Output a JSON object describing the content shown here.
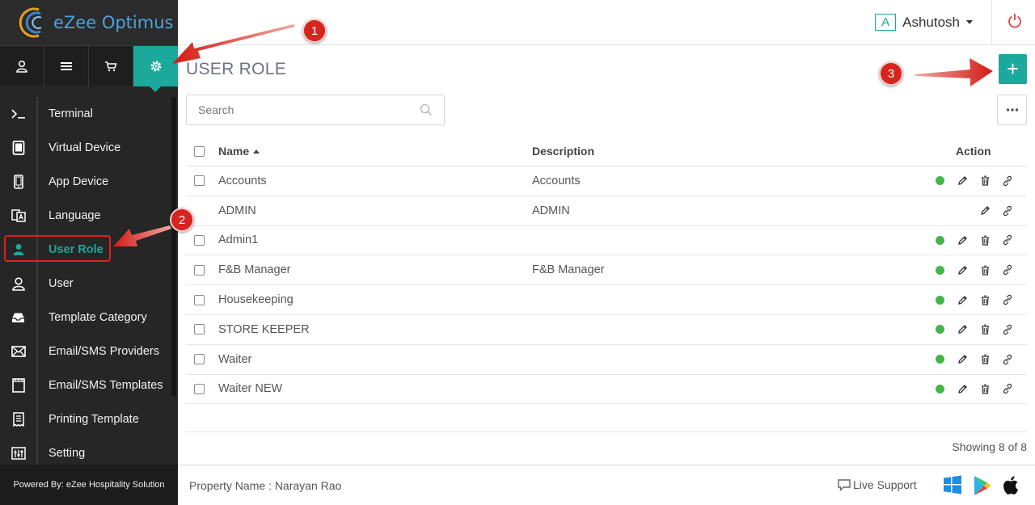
{
  "app": {
    "name": "eZee Optimus"
  },
  "header": {
    "avatar_letter": "A",
    "username": "Ashutosh"
  },
  "topnav": [
    {
      "name": "user-icon"
    },
    {
      "name": "menu-icon"
    },
    {
      "name": "cart-icon"
    },
    {
      "name": "gear-icon",
      "active": true
    }
  ],
  "sidebar": {
    "items": [
      {
        "label": "Terminal",
        "icon": "terminal-icon"
      },
      {
        "label": "Virtual Device",
        "icon": "tablet-icon"
      },
      {
        "label": "App Device",
        "icon": "phone-icon"
      },
      {
        "label": "Language",
        "icon": "language-icon"
      },
      {
        "label": "User Role",
        "icon": "user-role-icon",
        "active": true
      },
      {
        "label": "User",
        "icon": "user-icon"
      },
      {
        "label": "Template Category",
        "icon": "inbox-icon"
      },
      {
        "label": "Email/SMS Providers",
        "icon": "envelope-icon"
      },
      {
        "label": "Email/SMS Templates",
        "icon": "film-icon"
      },
      {
        "label": "Printing Template",
        "icon": "receipt-icon"
      },
      {
        "label": "Setting",
        "icon": "sliders-icon"
      }
    ],
    "footer": "Powered By: eZee Hospitality Solution"
  },
  "main": {
    "title": "USER ROLE",
    "add_label": "+",
    "search": {
      "placeholder": "Search"
    },
    "table": {
      "headers": {
        "name": "Name",
        "description": "Description",
        "action": "Action"
      },
      "rows": [
        {
          "name": "Accounts",
          "description": "Accounts",
          "checkbox": true,
          "status": true,
          "delete": true
        },
        {
          "name": "ADMIN",
          "description": "ADMIN",
          "checkbox": false,
          "status": false,
          "delete": false
        },
        {
          "name": "Admin1",
          "description": "",
          "checkbox": true,
          "status": true,
          "delete": true
        },
        {
          "name": "F&B Manager",
          "description": "F&B Manager",
          "checkbox": true,
          "status": true,
          "delete": true
        },
        {
          "name": "Housekeeping",
          "description": "",
          "checkbox": true,
          "status": true,
          "delete": true
        },
        {
          "name": "STORE KEEPER",
          "description": "",
          "checkbox": true,
          "status": true,
          "delete": true
        },
        {
          "name": "Waiter",
          "description": "",
          "checkbox": true,
          "status": true,
          "delete": true
        },
        {
          "name": "Waiter NEW",
          "description": "",
          "checkbox": true,
          "status": true,
          "delete": true
        }
      ]
    },
    "showing": "Showing 8 of 8"
  },
  "footer": {
    "property": "Property Name : Narayan Rao",
    "live_support": "Live Support"
  },
  "annotations": {
    "badge1": "1",
    "badge2": "2",
    "badge3": "3"
  },
  "colors": {
    "accent": "#1aa99a",
    "status": "#43b549",
    "annotation": "#d8241f",
    "sidebar": "#262626"
  }
}
